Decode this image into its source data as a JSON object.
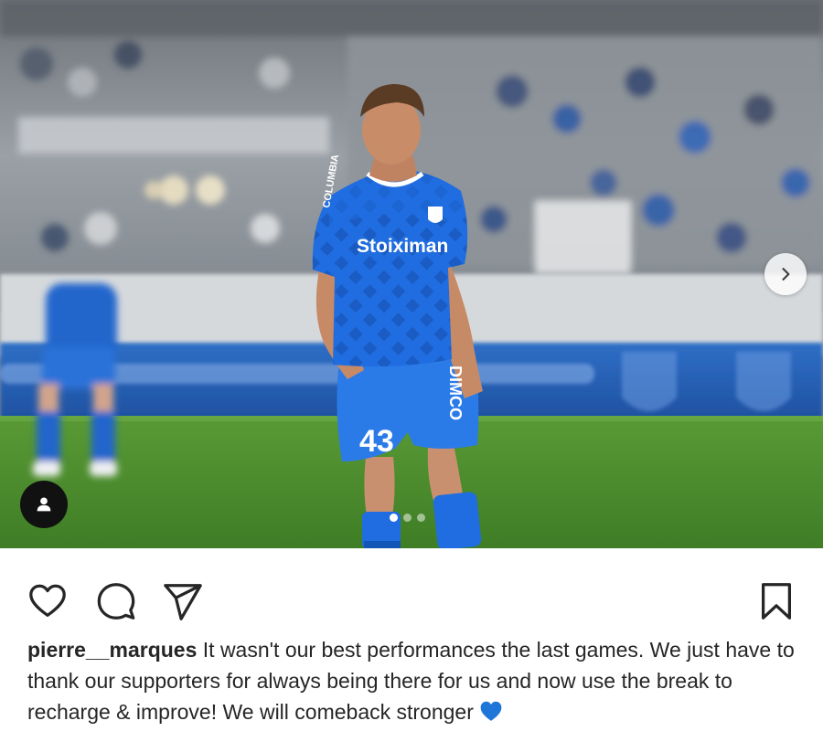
{
  "post": {
    "username": "pierre__marques",
    "caption": " It wasn't our best performances the last games. We just have to thank our supporters for always being there for us and now use the break to recharge & improve! We will comeback stronger",
    "caption_emoji": "blue-heart"
  },
  "photo": {
    "jersey_sponsor": "Stoiximan",
    "jersey_number": "43",
    "shorts_text": "DIMCO",
    "sleeve_text": "COLUMBIA",
    "kit_color": "#1f6de0",
    "pitch_color": "#4b8a2e"
  },
  "carousel": {
    "slide_count": 3,
    "active_index": 0
  },
  "icons": {
    "next": "chevron-right-icon",
    "tags": "user-tag-icon",
    "like": "heart-outline-icon",
    "comment": "comment-bubble-icon",
    "share": "paper-plane-icon",
    "save": "bookmark-icon"
  },
  "colors": {
    "emoji_heart": "#1e77d8",
    "text": "#262626"
  }
}
